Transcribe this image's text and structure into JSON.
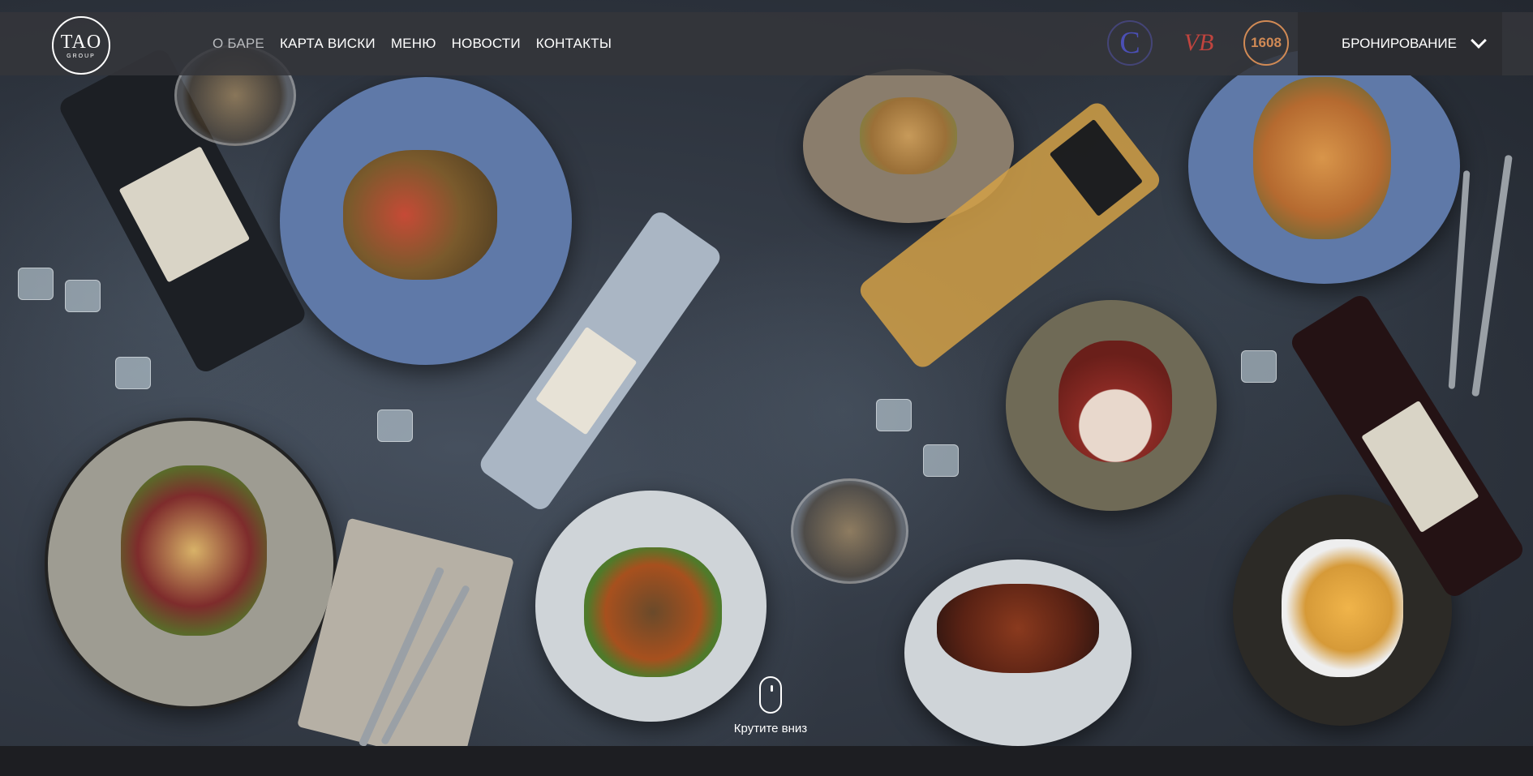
{
  "header": {
    "logo": {
      "mark": "TAO",
      "sub": "GROUP"
    },
    "nav": [
      {
        "label": "О БАРЕ",
        "active": true
      },
      {
        "label": "КАРТА ВИСКИ",
        "active": false
      },
      {
        "label": "МЕНЮ",
        "active": false
      },
      {
        "label": "НОВОСТИ",
        "active": false
      },
      {
        "label": "КОНТАКТЫ",
        "active": false
      }
    ],
    "partner_logos": [
      {
        "icon": "circle-c-logo",
        "text": "C",
        "color": "#4b4fb5"
      },
      {
        "icon": "vb-logo",
        "text": "VB",
        "color": "#c0443e"
      },
      {
        "icon": "1608-logo",
        "text": "1608",
        "color": "#d18a55"
      }
    ],
    "booking_label": "БРОНИРОВАНИЕ",
    "booking_icon": "chevron-down-icon"
  },
  "hero": {
    "scroll_label": "Крутите вниз",
    "scroll_icon": "mouse-icon"
  },
  "colors": {
    "navbar_bg": "#343639",
    "booking_bg": "#2b2c30",
    "nav_text": "#ffffff",
    "nav_active": "#b8babd",
    "page_bg": "#1d1e22"
  }
}
